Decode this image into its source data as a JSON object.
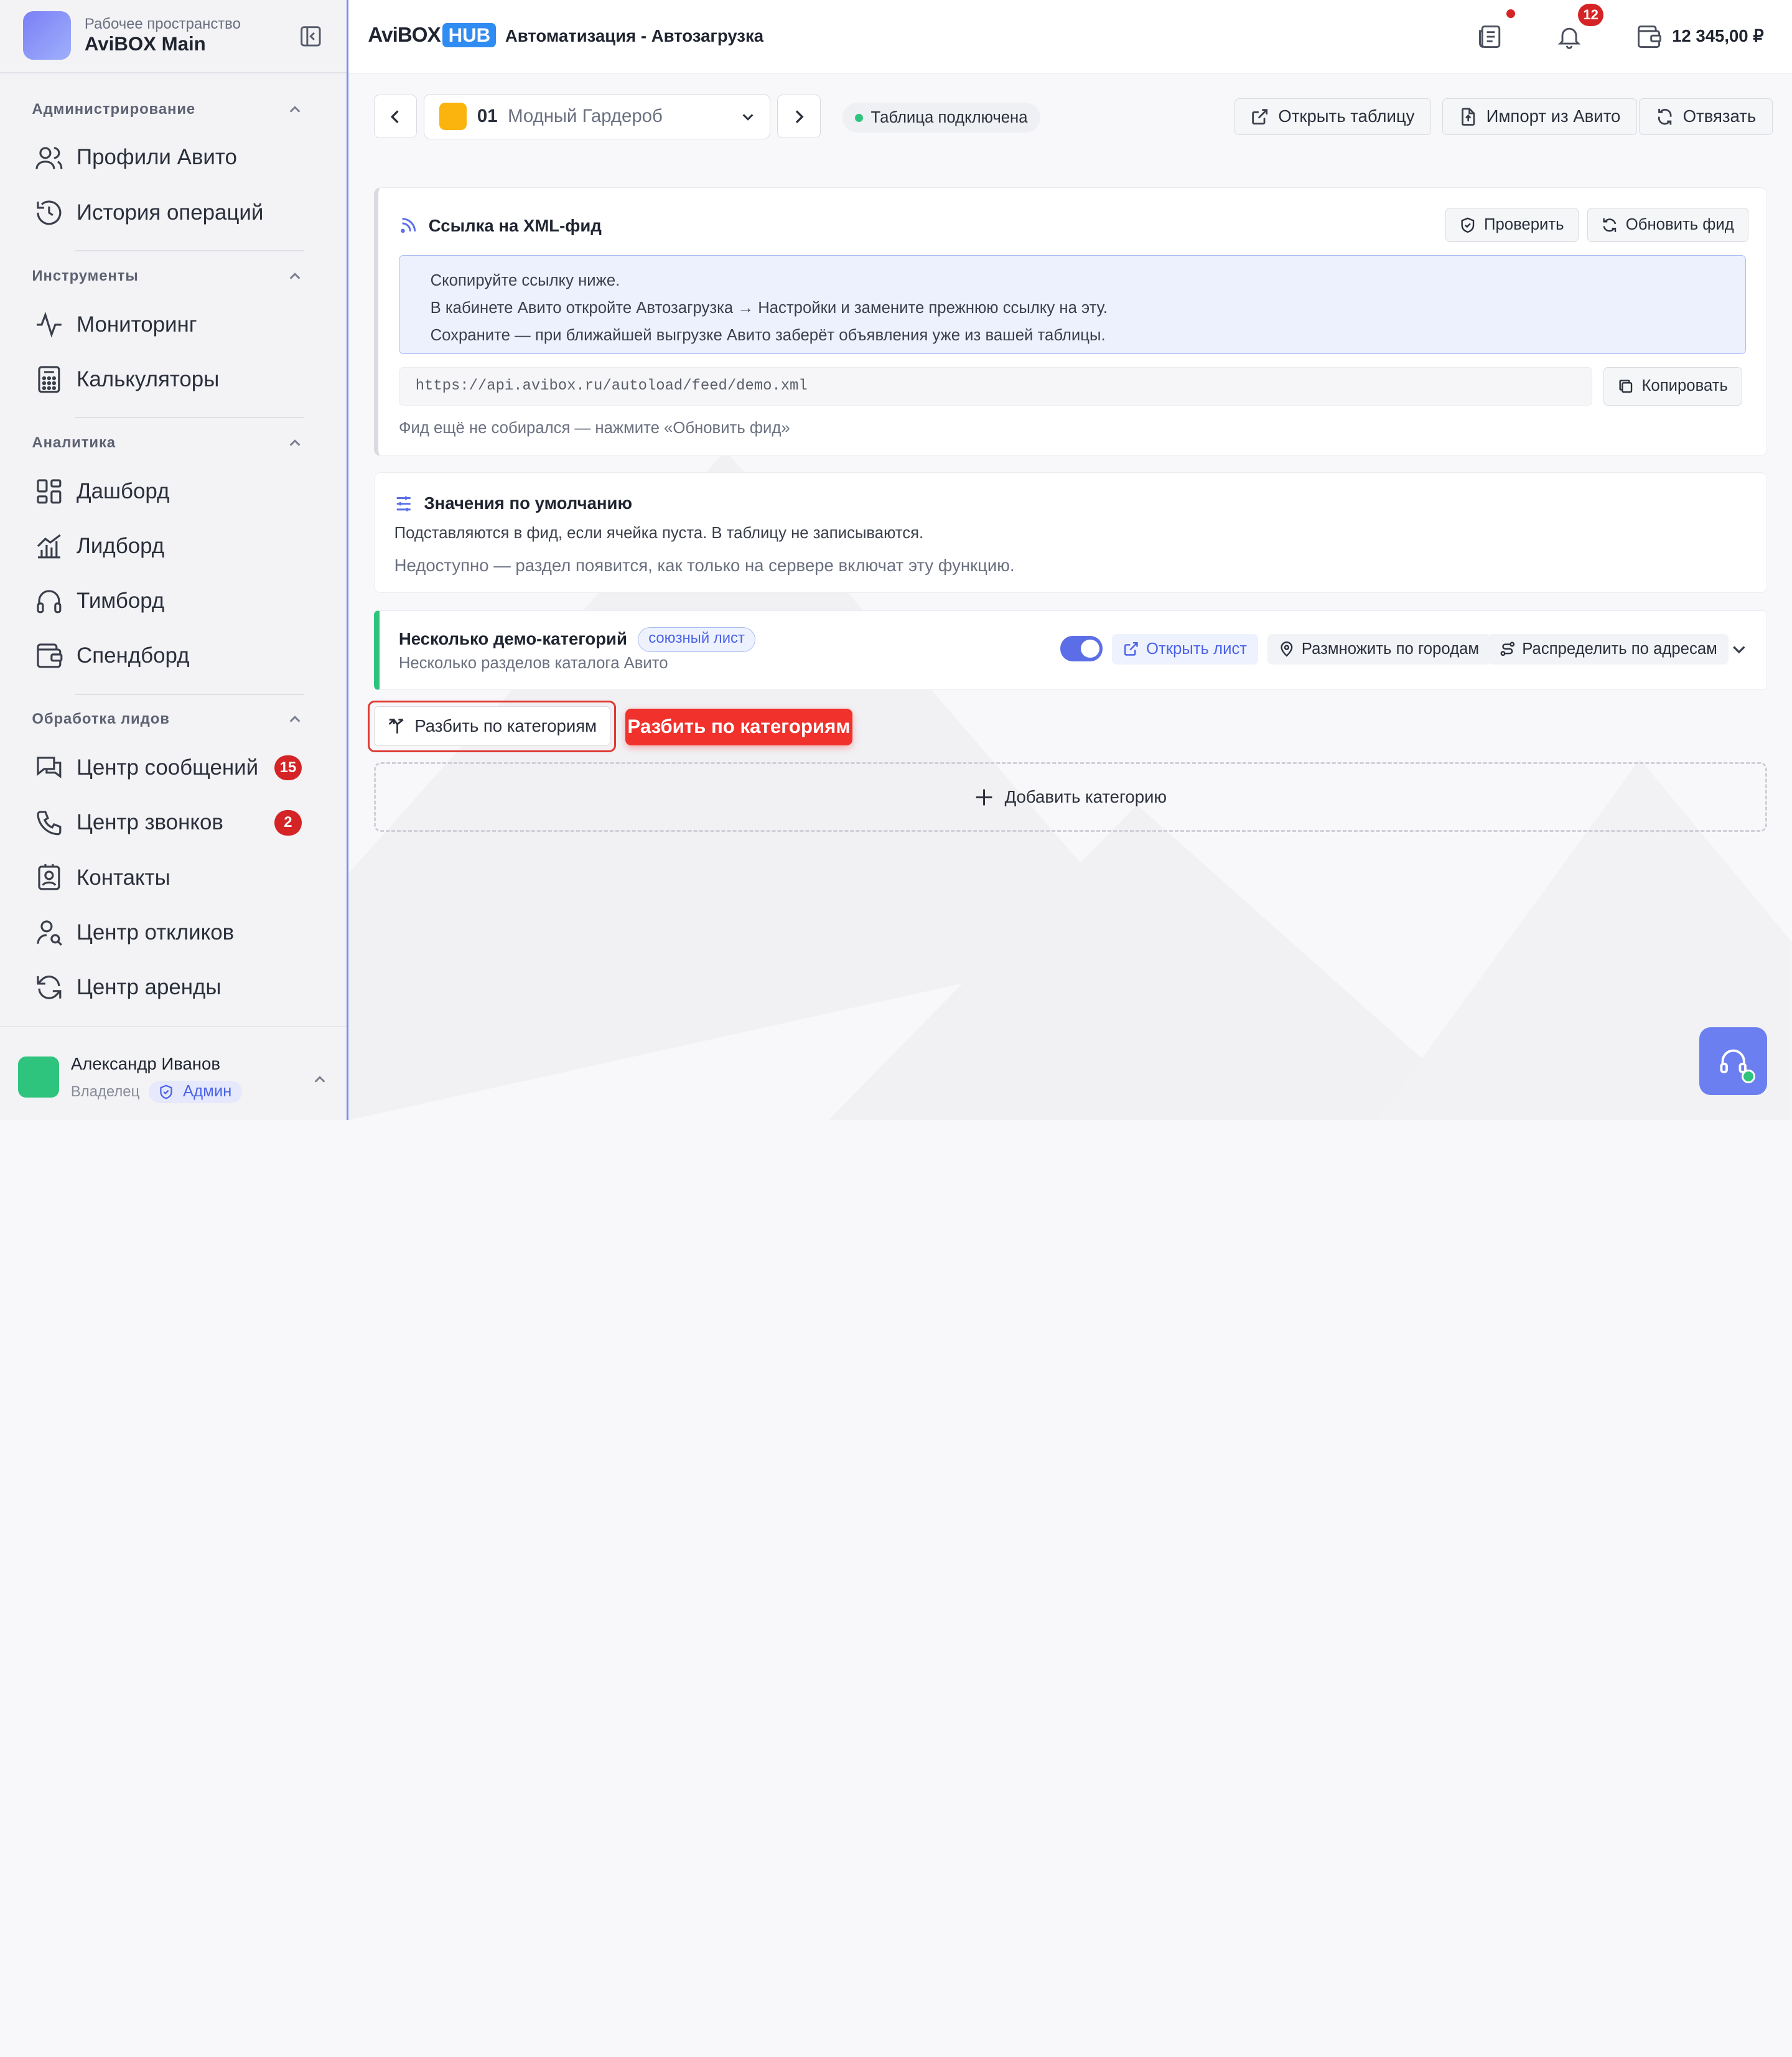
{
  "workspace": {
    "subtitle": "Рабочее пространство",
    "name": "AviBOX Main"
  },
  "sidebar": {
    "sections": [
      {
        "title": "Администрирование",
        "items": [
          {
            "label": "Профили Авито",
            "icon": "users-icon"
          },
          {
            "label": "История операций",
            "icon": "history-icon"
          }
        ]
      },
      {
        "title": "Инструменты",
        "items": [
          {
            "label": "Мониторинг",
            "icon": "activity-icon"
          },
          {
            "label": "Калькуляторы",
            "icon": "calculator-icon"
          }
        ]
      },
      {
        "title": "Аналитика",
        "items": [
          {
            "label": "Дашборд",
            "icon": "dashboard-icon"
          },
          {
            "label": "Лидборд",
            "icon": "chart-icon"
          },
          {
            "label": "Тимборд",
            "icon": "headphones-icon"
          },
          {
            "label": "Спендборд",
            "icon": "wallet-icon"
          }
        ]
      },
      {
        "title": "Обработка лидов",
        "items": [
          {
            "label": "Центр сообщений",
            "icon": "messages-icon",
            "badge": "15"
          },
          {
            "label": "Центр звонков",
            "icon": "phone-icon",
            "badge": "2"
          },
          {
            "label": "Контакты",
            "icon": "contacts-icon"
          },
          {
            "label": "Центр откликов",
            "icon": "user-search-icon"
          },
          {
            "label": "Центр аренды",
            "icon": "refresh-icon"
          }
        ]
      }
    ]
  },
  "user": {
    "name": "Александр Иванов",
    "role": "Владелец",
    "tag": "Админ"
  },
  "header": {
    "logo_text": "AviBOX",
    "logo_badge": "HUB",
    "title": "Автоматизация - Автозагрузка",
    "notifications_count": "12",
    "balance": "12 345,00 ₽"
  },
  "toolbar": {
    "profile_number": "01",
    "profile_name": "Модный Гардероб",
    "status": "Таблица подключена",
    "open_table": "Открыть таблицу",
    "import": "Импорт из Авито",
    "unlink": "Отвязать"
  },
  "feed": {
    "title": "Ссылка на XML-фид",
    "check": "Проверить",
    "refresh": "Обновить фид",
    "instructions": [
      "Скопируйте ссылку ниже.",
      "В кабинете Авито откройте Автозагрузка → Настройки и замените прежнюю ссылку на эту.",
      "Сохраните — при ближайшей выгрузке Авито заберёт объявления уже из вашей таблицы."
    ],
    "url": "https://api.avibox.ru/autoload/feed/demo.xml",
    "copy": "Копировать",
    "note": "Фид ещё не собирался — нажмите «Обновить фид»"
  },
  "defaults": {
    "title": "Значения по умолчанию",
    "description": "Подставляются в фид, если ячейка пуста. В таблицу не записываются.",
    "unavailable": "Недоступно — раздел появится, как только на сервере включат эту функцию."
  },
  "category": {
    "name": "Несколько демо-категорий",
    "tag": "союзный лист",
    "subtitle": "Несколько разделов каталога Авито",
    "enabled": true,
    "open_sheet": "Открыть лист",
    "multiply": "Размножить по городам",
    "distribute": "Распределить по адресам"
  },
  "split_button": "Разбить по категориям",
  "tooltip": "Разбить по категориям",
  "add_category": "Добавить категорию",
  "colors": {
    "accent": "#5b6ee8",
    "danger": "#d42426",
    "success": "#2fc47d",
    "brand": "#2f8cf3"
  }
}
